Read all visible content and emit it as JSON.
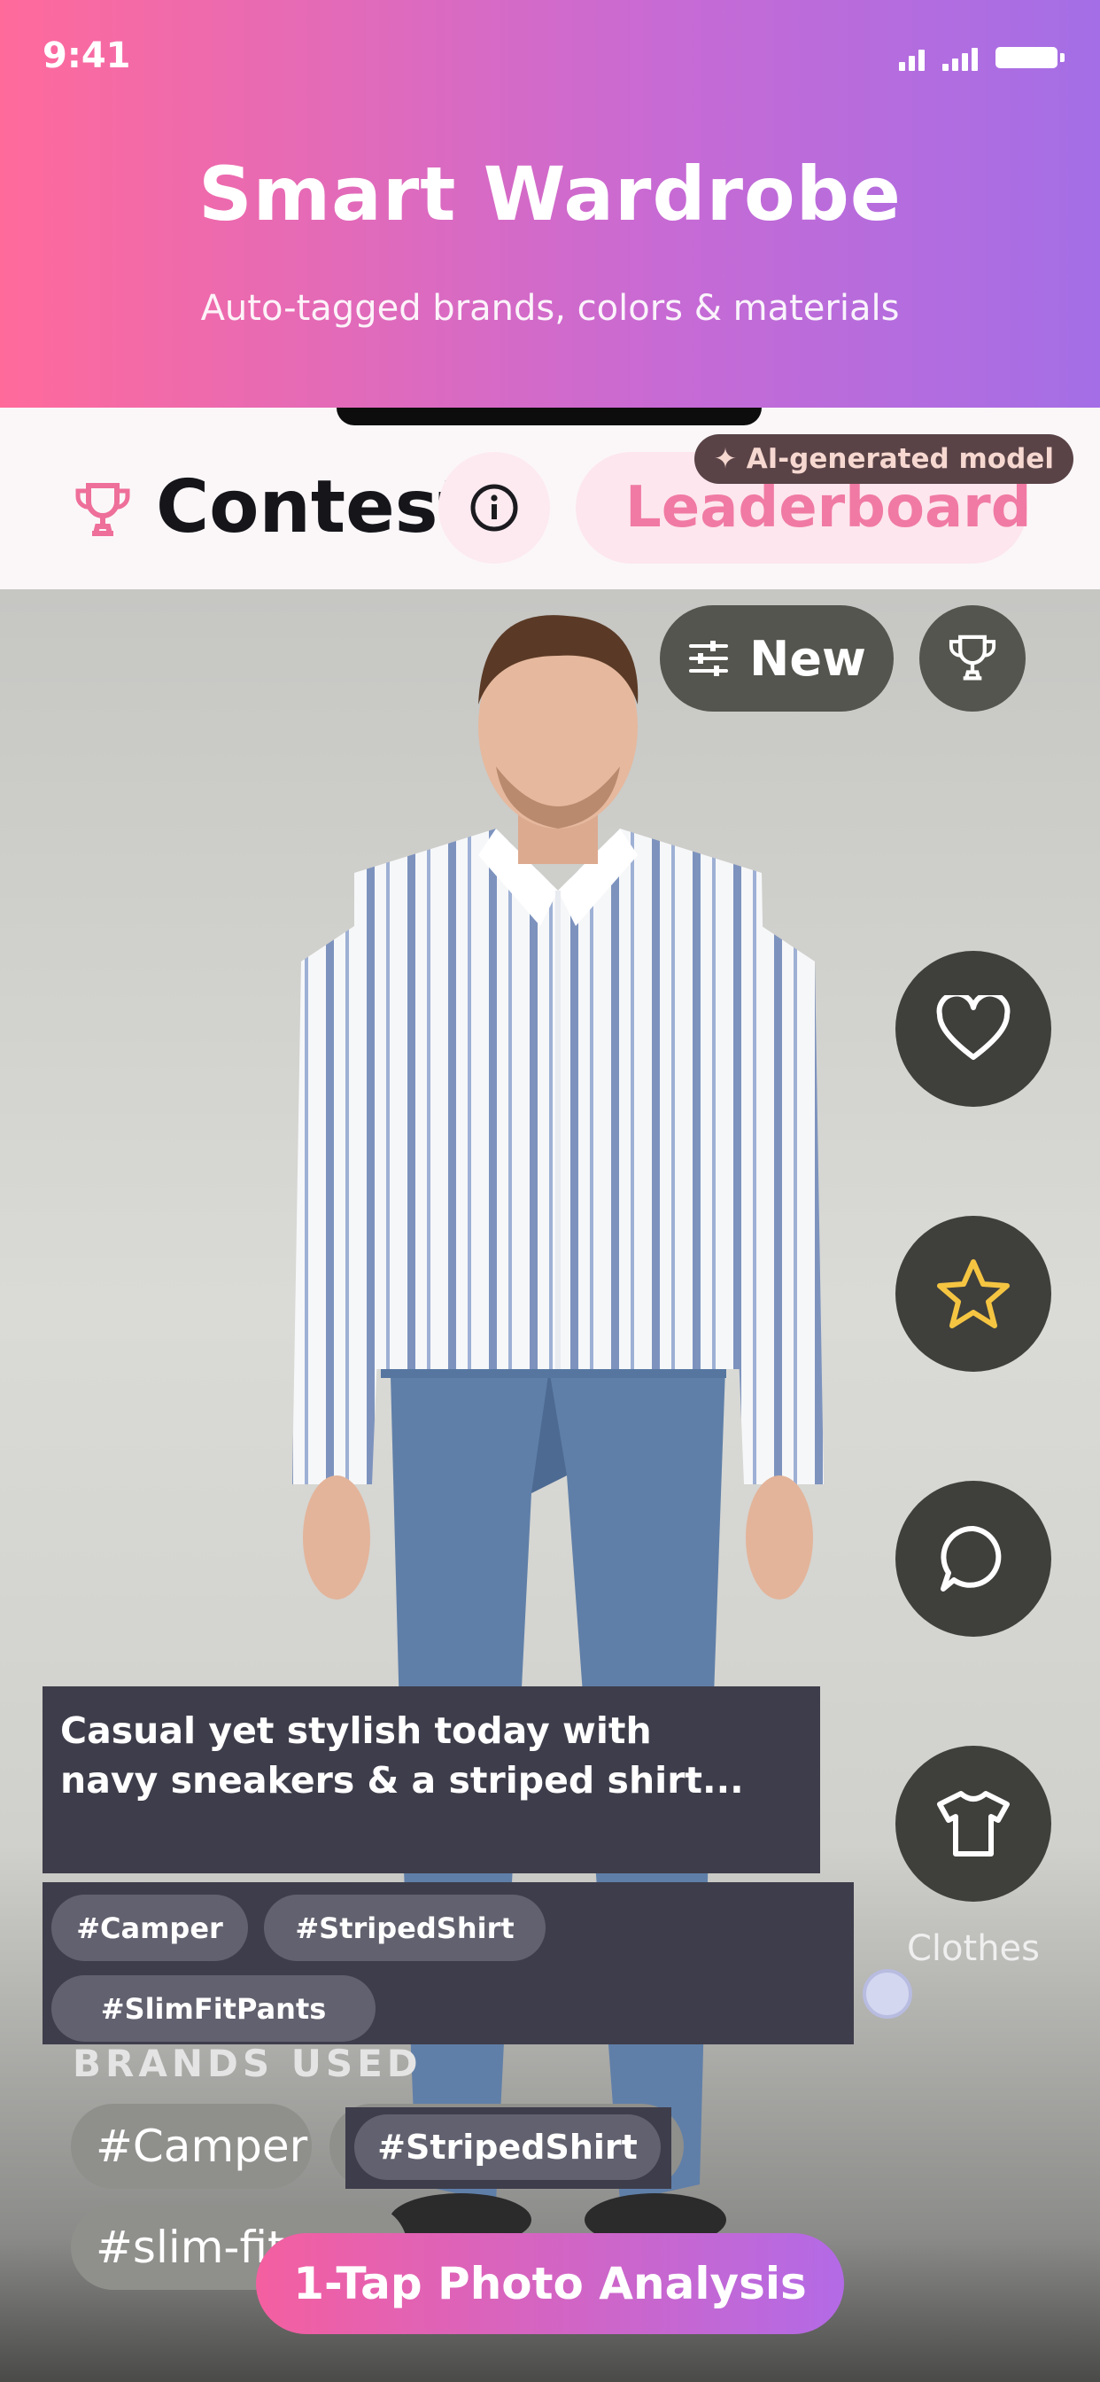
{
  "status_bar": {
    "time": "9:41"
  },
  "header": {
    "title": "Smart Wardrobe",
    "subtitle": "Auto-tagged brands, colors & materials"
  },
  "topbar": {
    "contest_label": "Contest",
    "leaderboard_label": "Leaderboard",
    "ai_badge": "✦ AI-generated model"
  },
  "feed": {
    "filter_label": "New",
    "side_actions": {
      "clothes_label": "Clothes"
    },
    "caption": {
      "line1": "Casual yet stylish today with",
      "line2": "navy sneakers & a striped shirt..."
    },
    "tags": [
      "#Camper",
      "#StripedShirt",
      "#SlimFitPants"
    ],
    "brands_title": "BRANDS USED",
    "brand_chips": [
      "#Camper",
      "#StripedShirt",
      "#slim-fit"
    ]
  },
  "cta": {
    "label": "1-Tap Photo Analysis"
  },
  "colors": {
    "header_gradient_start": "#ff6a9b",
    "header_gradient_end": "#a46ee6",
    "leaderboard_pink": "#f07aa3",
    "star_yellow": "#f5c542"
  }
}
